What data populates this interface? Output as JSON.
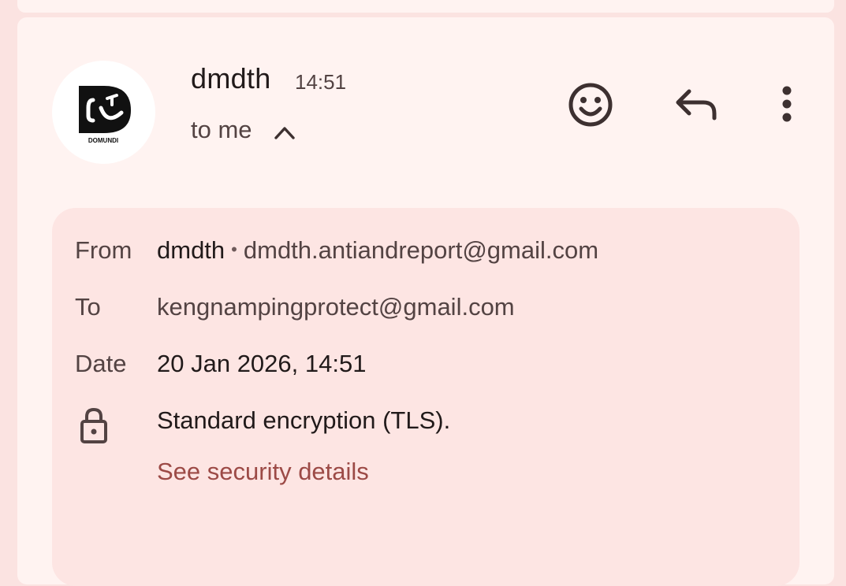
{
  "message": {
    "sender_name": "dmdth",
    "time": "14:51",
    "recipient_summary": "to me",
    "avatar": {
      "icon": "domundi-logo",
      "logo_text": "DOMUNDI"
    }
  },
  "actions": {
    "emoji": "emoji-reaction-icon",
    "reply": "reply-icon",
    "more": "more-vert-icon"
  },
  "details": {
    "from_label": "From",
    "from_name": "dmdth",
    "from_separator": "•",
    "from_email": "dmdth.antiandreport@gmail.com",
    "to_label": "To",
    "to_email": "kengnampingprotect@gmail.com",
    "date_label": "Date",
    "date_value": "20 Jan 2026, 14:51",
    "encryption_text": "Standard encryption (TLS).",
    "security_link": "See security details"
  },
  "colors": {
    "background": "#fbe3e1",
    "card": "#fff3f1",
    "details_panel": "#fde5e3",
    "link": "#9c4a46"
  }
}
